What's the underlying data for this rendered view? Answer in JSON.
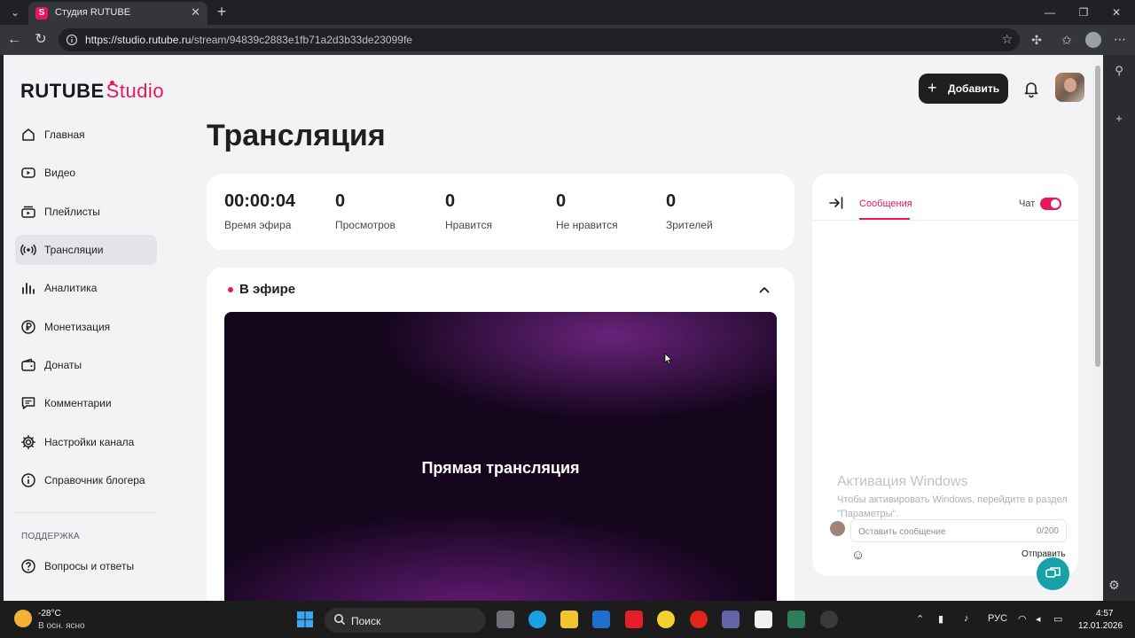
{
  "browser": {
    "tab_title": "Студия RUTUBE",
    "tab_favicon": "S",
    "url_host": "https://studio.rutube.ru",
    "url_path": "/stream/94839c2883e1fb71a2d3b33de23099fe"
  },
  "header": {
    "logo_main": "RUTUBE",
    "logo_sub": "Studio",
    "add_label": "Добавить"
  },
  "sidebar": {
    "items": [
      {
        "label": "Главная"
      },
      {
        "label": "Видео"
      },
      {
        "label": "Плейлисты"
      },
      {
        "label": "Трансляции"
      },
      {
        "label": "Аналитика"
      },
      {
        "label": "Монетизация"
      },
      {
        "label": "Донаты"
      },
      {
        "label": "Комментарии"
      },
      {
        "label": "Настройки канала"
      },
      {
        "label": "Справочник блогера"
      }
    ],
    "support_heading": "ПОДДЕРЖКА",
    "support_items": [
      {
        "label": "Вопросы и ответы"
      }
    ]
  },
  "main": {
    "title": "Трансляция",
    "stats": [
      {
        "value": "00:00:04",
        "label": "Время эфира"
      },
      {
        "value": "0",
        "label": "Просмотров"
      },
      {
        "value": "0",
        "label": "Нравится"
      },
      {
        "value": "0",
        "label": "Не нравится"
      },
      {
        "value": "0",
        "label": "Зрителей"
      }
    ],
    "live_title": "В эфире",
    "player_text": "Прямая трансляция"
  },
  "chat": {
    "tab_messages": "Сообщения",
    "chat_label": "Чат",
    "chat_enabled": true,
    "input_placeholder": "Оставить сообщение",
    "counter": "0/200",
    "send_label": "Отправить"
  },
  "watermark": {
    "line1": "Активация Windows",
    "line2": "Чтобы активировать Windows, перейдите в раздел \"Параметры\"."
  },
  "taskbar": {
    "temperature": "-28°C",
    "weather_desc": "В осн. ясно",
    "search_label": "Поиск",
    "language": "РУС",
    "time": "4:57",
    "date": "12.01.2026"
  },
  "colors": {
    "accent": "#e5185b",
    "button_dark": "#1f1f22",
    "page_bg": "#f3f3f5",
    "help_fab": "#17a2a8"
  }
}
